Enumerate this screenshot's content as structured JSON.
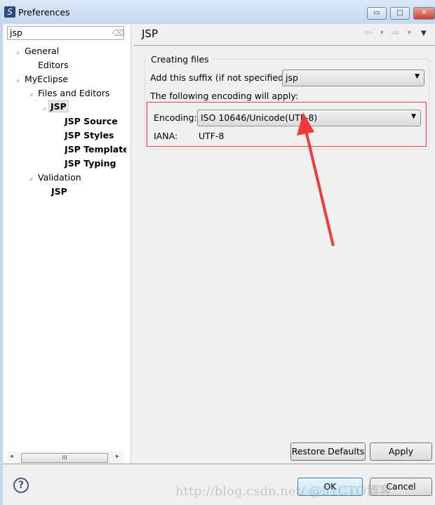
{
  "window": {
    "title": "Preferences",
    "minimize": "▭",
    "maximize": "□",
    "close": "✕"
  },
  "search": {
    "value": "jsp"
  },
  "tree": [
    {
      "label": "General"
    },
    {
      "label": "Editors"
    },
    {
      "label": "MyEclipse"
    },
    {
      "label": "Files and Editors"
    },
    {
      "label": "JSP"
    },
    {
      "label": "JSP Source"
    },
    {
      "label": "JSP Styles"
    },
    {
      "label": "JSP Templates"
    },
    {
      "label": "JSP Typing"
    },
    {
      "label": "Validation"
    },
    {
      "label": "JSP"
    }
  ],
  "page": {
    "title": "JSP",
    "nav": {
      "back": "⇦",
      "forward": "⇨",
      "menu": "▼",
      "dropdown": "▾"
    }
  },
  "group": {
    "label": "Creating files",
    "suffix_label": "Add this suffix (if not specified):",
    "suffix_value": "jsp",
    "encoding_note": "The following encoding will apply:",
    "encoding_label": "Encoding:",
    "encoding_value": "ISO 10646/Unicode(UTF-8)",
    "iana_label": "IANA:",
    "iana_value": "UTF-8"
  },
  "buttons": {
    "restore": "Restore Defaults",
    "apply": "Apply",
    "ok": "OK",
    "cancel": "Cancel",
    "help": "?"
  },
  "scrollbar": {
    "grip": "III",
    "left": "◂",
    "right": "▸"
  },
  "watermark": "http://blog.csdn.net/ @51CTO博客",
  "colors": {
    "annotation": "#f23a3a"
  }
}
